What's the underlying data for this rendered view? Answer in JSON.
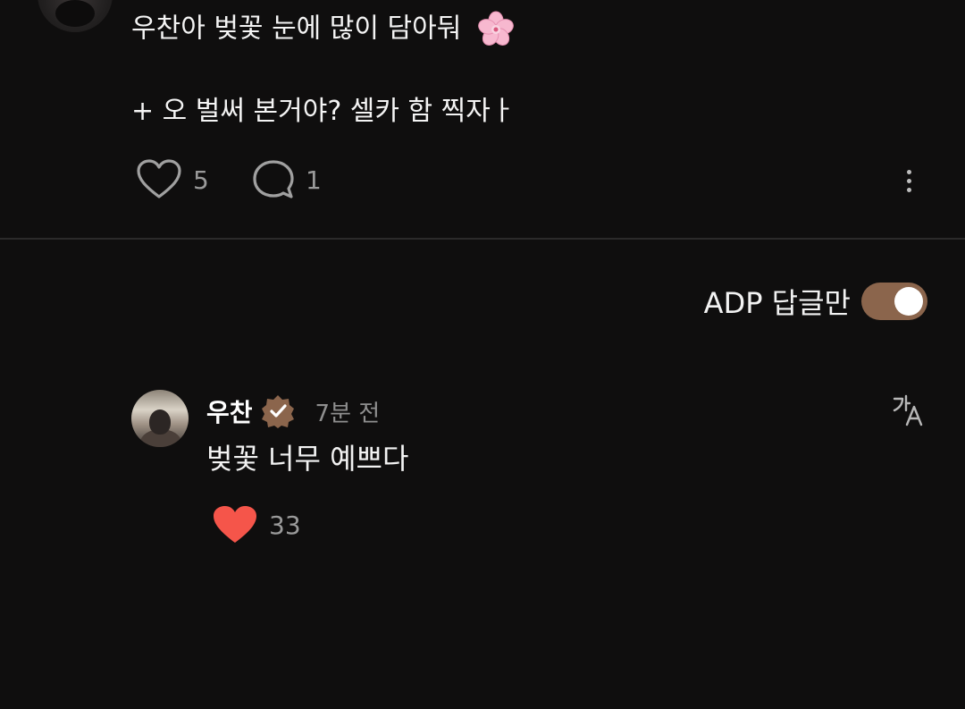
{
  "post": {
    "text_line1": "우찬아 벚꽃 눈에 많이 담아둬",
    "emoji": "cherry-blossom",
    "text_line2": "+ 오 벌써 본거야? 셀카 함 찍자ㅏ",
    "like_count": "5",
    "reply_count": "1"
  },
  "filter": {
    "label": "ADP 답글만",
    "enabled": true
  },
  "reply": {
    "author": "우찬",
    "time": "7분 전",
    "text": "벚꽃 너무 예쁘다",
    "like_count": "33",
    "liked": true
  },
  "colors": {
    "background": "#0f0e0e",
    "accent": "#8b654c",
    "like_red": "#f5554a",
    "muted_text": "#9a9a9a",
    "divider": "#2b2a2a"
  },
  "icons": {
    "like": "heart-outline-icon",
    "reply": "speech-bubble-icon",
    "more": "vertical-dots-icon",
    "verified": "verified-badge-icon",
    "translate": "translate-icon",
    "liked": "heart-filled-icon"
  }
}
